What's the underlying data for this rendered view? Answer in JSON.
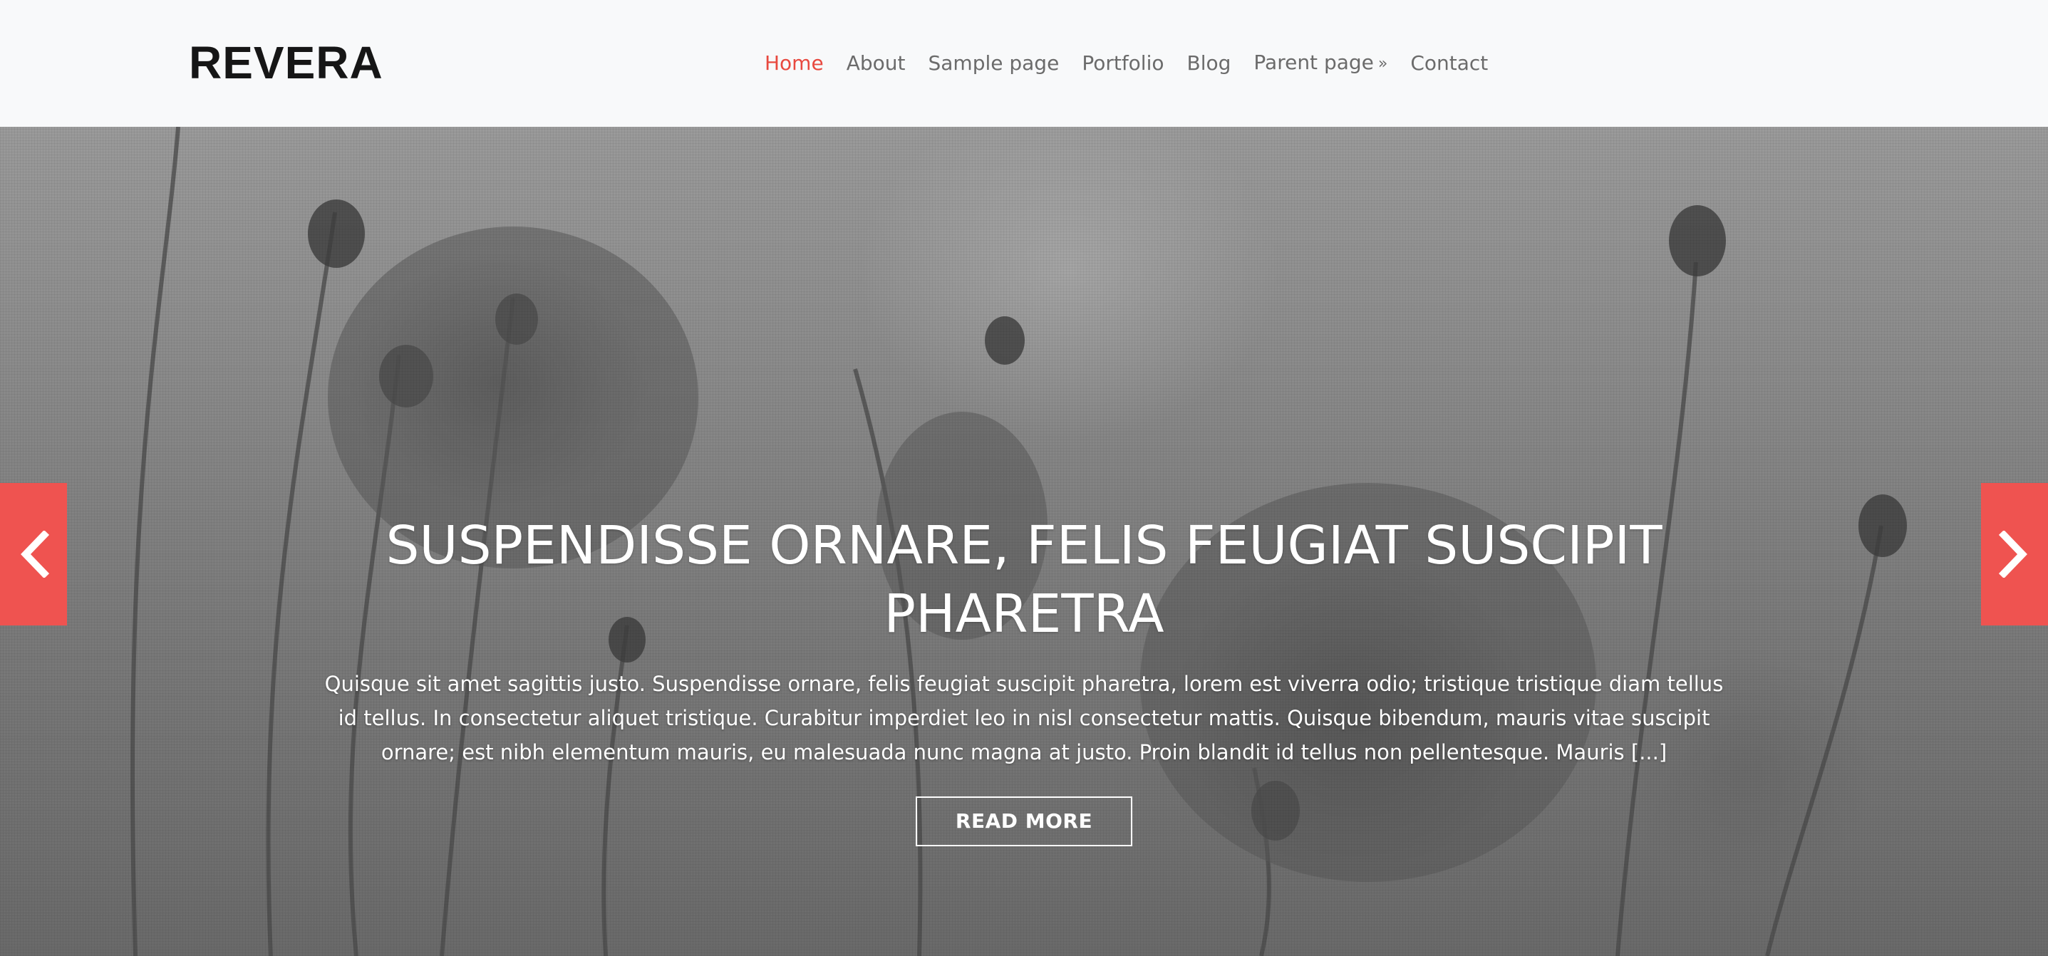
{
  "site": {
    "title": "REVERA"
  },
  "nav": {
    "items": [
      {
        "label": "Home",
        "active": true
      },
      {
        "label": "About"
      },
      {
        "label": "Sample page"
      },
      {
        "label": "Portfolio"
      },
      {
        "label": "Blog"
      },
      {
        "label": "Parent page",
        "suffix": "»"
      },
      {
        "label": "Contact"
      }
    ]
  },
  "slider": {
    "title": "SUSPENDISSE ORNARE, FELIS FEUGIAT SUSCIPIT PHARETRA",
    "excerpt": "Quisque sit amet sagittis justo. Suspendisse ornare, felis feugiat suscipit pharetra, lorem est viverra odio; tristique tristique diam tellus id tellus. In consectetur aliquet tristique. Curabitur imperdiet leo in nisl consectetur mattis. Quisque bibendum, mauris vitae suscipit ornare; est nibh elementum mauris, eu malesuada nunc magna at justo. Proin blandit id tellus non pellentesque. Mauris [...]",
    "button_label": "READ MORE",
    "prev_icon": "chevron-left-icon",
    "next_icon": "chevron-right-icon"
  },
  "colors": {
    "accent": "#ef5350",
    "nav_active": "#e8493f",
    "nav_text": "#6b6b6b",
    "logo": "#161616",
    "header_bg": "#f8f9fa"
  }
}
